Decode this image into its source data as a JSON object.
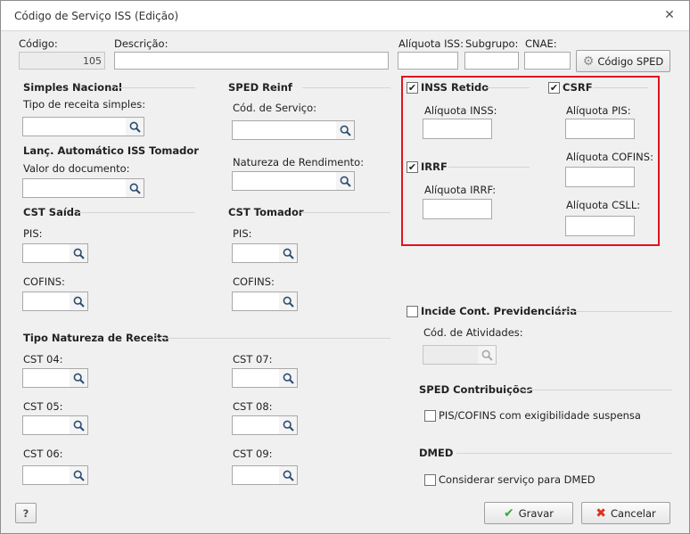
{
  "window": {
    "title": "Código de Serviço ISS (Edição)"
  },
  "top": {
    "codigo_label": "Código:",
    "codigo_value": "105",
    "descricao_label": "Descrição:",
    "aliquota_iss_label": "Alíquota ISS:",
    "subgrupo_label": "Subgrupo:",
    "cnae_label": "CNAE:",
    "sped_button_label": "Código SPED"
  },
  "simples": {
    "header": "Simples Nacional",
    "tipo_label": "Tipo de receita simples:"
  },
  "lanc": {
    "header": "Lanç. Automático ISS Tomador",
    "valor_label": "Valor do documento:"
  },
  "reinf": {
    "header": "SPED Reinf",
    "servico_label": "Cód. de Serviço:",
    "natureza_label": "Natureza de Rendimento:"
  },
  "cst_saida": {
    "header": "CST Saída",
    "pis_label": "PIS:",
    "cofins_label": "COFINS:"
  },
  "cst_tomador": {
    "header": "CST Tomador",
    "pis_label": "PIS:",
    "cofins_label": "COFINS:"
  },
  "natureza": {
    "header": "Tipo Natureza de Receita",
    "cst04": "CST 04:",
    "cst05": "CST 05:",
    "cst06": "CST 06:",
    "cst07": "CST 07:",
    "cst08": "CST 08:",
    "cst09": "CST 09:"
  },
  "retencoes": {
    "inss_label": "INSS Retido",
    "inss_checked": true,
    "aliquota_inss_label": "Alíquota INSS:",
    "irrf_label": "IRRF",
    "irrf_checked": true,
    "aliquota_irrf_label": "Alíquota IRRF:",
    "csrf_label": "CSRF",
    "csrf_checked": true,
    "aliquota_pis_label": "Alíquota PIS:",
    "aliquota_cofins_label": "Alíquota COFINS:",
    "aliquota_csll_label": "Alíquota CSLL:"
  },
  "previdencia": {
    "label": "Incide Cont. Previdenciária",
    "checked": false,
    "atividades_label": "Cód. de Atividades:"
  },
  "sped_contrib": {
    "header": "SPED Contribuições",
    "pis_cofins_label": "PIS/COFINS com exigibilidade suspensa",
    "checked": false
  },
  "dmed": {
    "header": "DMED",
    "considerar_label": "Considerar serviço para DMED",
    "checked": false
  },
  "footer": {
    "help_label": "?",
    "gravar_label": "Gravar",
    "cancelar_label": "Cancelar"
  },
  "colors": {
    "highlight_border": "#e0141e",
    "gravar_icon": "#3da53d",
    "cancelar_icon": "#d9341f"
  }
}
